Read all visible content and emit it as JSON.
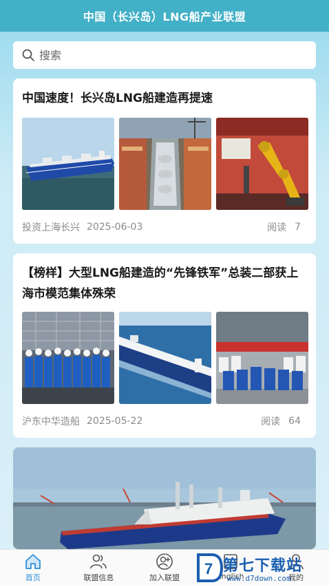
{
  "header": {
    "title": "中国（长兴岛）LNG船产业联盟"
  },
  "search": {
    "placeholder": "搜索"
  },
  "articles": [
    {
      "title": "中国速度！长兴岛LNG船建造再提速",
      "images": [
        "lng-carrier-at-sea",
        "shipyard-dock-construction",
        "yellow-welding-robot"
      ],
      "source": "投资上海长兴",
      "date": "2025-06-03",
      "read_label": "阅读",
      "read_count": "7"
    },
    {
      "title": "【榜样】大型LNG船建造的“先锋铁军”总装二部获上海市模范集体殊荣",
      "images": [
        "workers-group-in-workshop",
        "lng-carrier-sailing",
        "team-photo-with-banner"
      ],
      "source": "沪东中华造船",
      "date": "2025-05-22",
      "read_label": "阅读",
      "read_count": "64"
    },
    {
      "images": [
        "lng-carrier-large-banner"
      ]
    }
  ],
  "tabbar": {
    "items": [
      {
        "label": "首页",
        "icon": "home-icon",
        "active": true
      },
      {
        "label": "联盟信息",
        "icon": "people-icon",
        "active": false
      },
      {
        "label": "加入联盟",
        "icon": "add-user-icon",
        "active": false
      },
      {
        "label": "English",
        "icon": "globe-icon",
        "active": false
      },
      {
        "label": "我的",
        "icon": "user-icon",
        "active": false
      }
    ]
  },
  "watermark": {
    "title": "第七下载站",
    "url": "www.d7down.com"
  },
  "colors": {
    "header": "#42b0c6",
    "active_tab": "#2f8fd8",
    "watermark": "#1a5fb0"
  }
}
